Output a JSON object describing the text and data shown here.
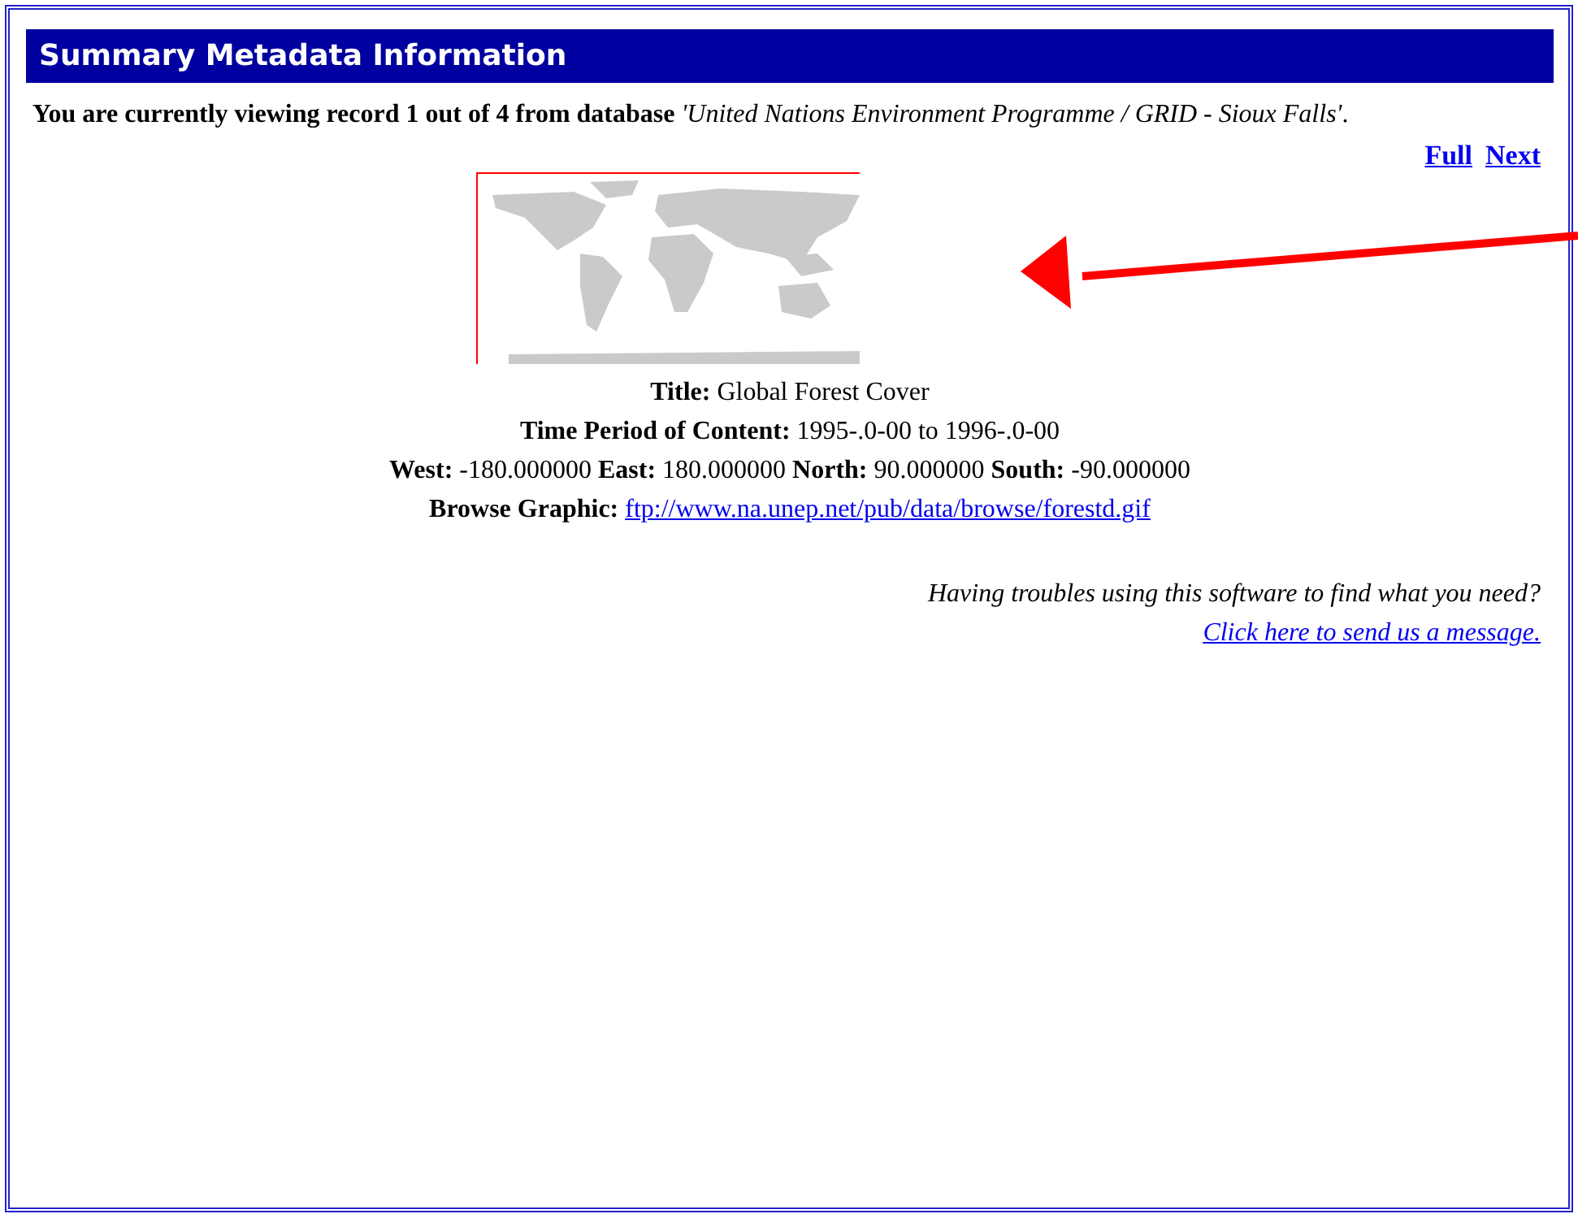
{
  "header": {
    "title": "Summary Metadata Information"
  },
  "intro": "**You are currently viewing record 1 out of 4 from database** *'United Nations Environment Programme / GRID - Sioux Falls'*.",
  "nav_links": [
    "Full",
    "Next"
  ],
  "metadata": [
    {
      "text": "**Title:** Global Forest Cover"
    },
    {
      "text": "**Time Period of Content:** 1995-.0-00 to 1996-.0-00"
    },
    {
      "text": "**West:** -180.000000 **East:** 180.000000 **North:** 90.000000 **South:** -90.000000"
    },
    {
      "text": "**Browse Graphic:**",
      "link": "ftp://www.na.unep.net/pub/data/browse/forestd.gif"
    }
  ],
  "help": {
    "question": "Having troubles using this software to find what you need?",
    "link": "Click here to send us a message."
  }
}
